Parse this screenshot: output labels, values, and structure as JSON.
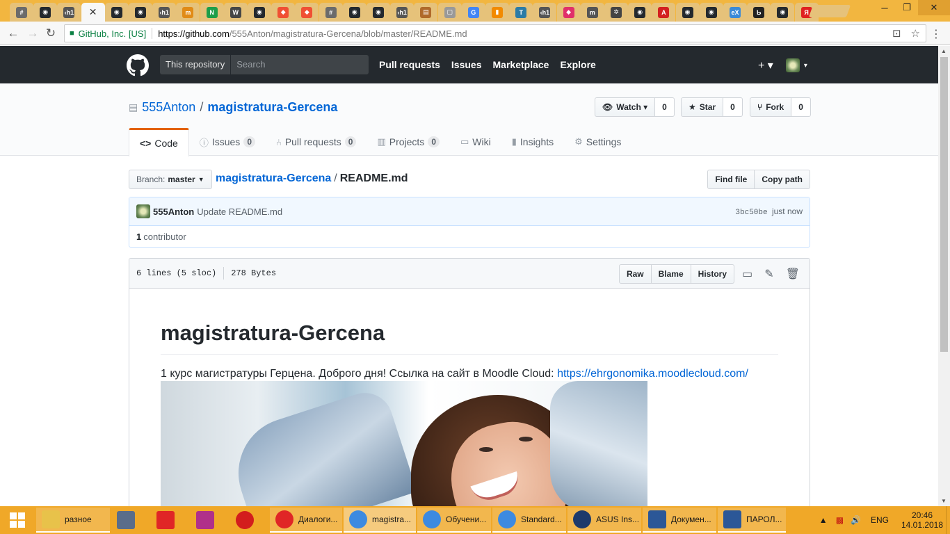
{
  "browser": {
    "tabs": [
      {
        "icon": "hash-icon",
        "color": "#6b6b6b",
        "glyph": "#"
      },
      {
        "icon": "github-icon",
        "color": "#24292e",
        "glyph": "◉"
      },
      {
        "icon": "h1-icon",
        "color": "#555",
        "glyph": "‹h1"
      },
      {
        "icon": "close-icon",
        "color": "#333",
        "glyph": "✕",
        "active": true
      },
      {
        "icon": "github-icon",
        "color": "#24292e",
        "glyph": "◉"
      },
      {
        "icon": "github-icon",
        "color": "#24292e",
        "glyph": "◉"
      },
      {
        "icon": "h1-icon",
        "color": "#555",
        "glyph": "‹h1"
      },
      {
        "icon": "m-icon",
        "color": "#e18b16",
        "glyph": "m"
      },
      {
        "icon": "n-icon",
        "color": "#1e9e4a",
        "glyph": "N"
      },
      {
        "icon": "wordpress-icon",
        "color": "#464646",
        "glyph": "W"
      },
      {
        "icon": "github-icon",
        "color": "#24292e",
        "glyph": "◉"
      },
      {
        "icon": "git-icon",
        "color": "#f05033",
        "glyph": "◆"
      },
      {
        "icon": "git-icon",
        "color": "#f05033",
        "glyph": "◆"
      },
      {
        "icon": "hash-icon",
        "color": "#6b6b6b",
        "glyph": "#"
      },
      {
        "icon": "github-icon",
        "color": "#24292e",
        "glyph": "◉"
      },
      {
        "icon": "github-icon",
        "color": "#24292e",
        "glyph": "◉"
      },
      {
        "icon": "h1-icon",
        "color": "#555",
        "glyph": "‹h1"
      },
      {
        "icon": "image-icon",
        "color": "#b06a2a",
        "glyph": "▤"
      },
      {
        "icon": "page-icon",
        "color": "#999",
        "glyph": "▢"
      },
      {
        "icon": "google-icon",
        "color": "#4285f4",
        "glyph": "G"
      },
      {
        "icon": "chart-icon",
        "color": "#f28a00",
        "glyph": "▮"
      },
      {
        "icon": "t-icon",
        "color": "#2c7ba6",
        "glyph": "T"
      },
      {
        "icon": "h1-icon",
        "color": "#555",
        "glyph": "‹h1"
      },
      {
        "icon": "bookmark-icon",
        "color": "#e0306a",
        "glyph": "◆"
      },
      {
        "icon": "m-icon",
        "color": "#555",
        "glyph": "m"
      },
      {
        "icon": "gear-icon",
        "color": "#444",
        "glyph": "✲"
      },
      {
        "icon": "github-icon",
        "color": "#24292e",
        "glyph": "◉"
      },
      {
        "icon": "opera-icon",
        "color": "#d32020",
        "glyph": "A"
      },
      {
        "icon": "github-icon",
        "color": "#24292e",
        "glyph": "◉"
      },
      {
        "icon": "github-icon",
        "color": "#24292e",
        "glyph": "◉"
      },
      {
        "icon": "ex-icon",
        "color": "#3a8ad8",
        "glyph": "eX"
      },
      {
        "icon": "b-icon",
        "color": "#222",
        "glyph": "Ƅ"
      },
      {
        "icon": "github-icon",
        "color": "#24292e",
        "glyph": "◉"
      },
      {
        "icon": "yandex-icon",
        "color": "#e02020",
        "glyph": "Я"
      }
    ],
    "security_label": "GitHub, Inc. [US]",
    "url_host": "https://github.com",
    "url_path": "/555Anton/magistratura-Gercena/blob/master/README.md"
  },
  "github": {
    "scope_label": "This repository",
    "search_placeholder": "Search",
    "nav": [
      "Pull requests",
      "Issues",
      "Marketplace",
      "Explore"
    ],
    "plus_label": "+ ▾",
    "owner": "555Anton",
    "repo": "magistratura-Gercena",
    "watch": {
      "label": "Watch ▾",
      "count": "0"
    },
    "star": {
      "label": "Star",
      "count": "0"
    },
    "fork": {
      "label": "Fork",
      "count": "0"
    },
    "tabs": {
      "code": "Code",
      "issues": "Issues",
      "issues_count": "0",
      "pulls": "Pull requests",
      "pulls_count": "0",
      "projects": "Projects",
      "projects_count": "0",
      "wiki": "Wiki",
      "insights": "Insights",
      "settings": "Settings"
    },
    "branch_key": "Branch:",
    "branch_val": "master",
    "breadcrumb_repo": "magistratura-Gercena",
    "breadcrumb_file": "README.md",
    "find_file": "Find file",
    "copy_path": "Copy path",
    "commit": {
      "author": "555Anton",
      "message": "Update README.md",
      "sha": "3bc50be",
      "time": "just now",
      "contributors_count": "1",
      "contributors_label": "contributor"
    },
    "file": {
      "lines": "6 lines (5 sloc)",
      "size": "278 Bytes",
      "raw": "Raw",
      "blame": "Blame",
      "history": "History"
    },
    "readme": {
      "title": "magistratura-Gercena",
      "text": "1 курс магистратуры Герцена. Доброго дня! Ссылка на сайт в Moodle Cloud: ",
      "link": "https://ehrgonomika.moodlecloud.com/"
    }
  },
  "taskbar": {
    "apps": [
      {
        "label": "разное",
        "icon": "folder-icon",
        "color": "#e8c24a",
        "state": "open"
      },
      {
        "label": "",
        "icon": "calculator-icon",
        "color": "#5a6d8a",
        "state": ""
      },
      {
        "label": "",
        "icon": "fr-icon",
        "color": "#e02626",
        "state": ""
      },
      {
        "label": "",
        "icon": "camera-icon",
        "color": "#b0308a",
        "state": ""
      },
      {
        "label": "",
        "icon": "opera-icon",
        "color": "#d31d1d",
        "state": ""
      },
      {
        "label": "Диалоги...",
        "icon": "yandex-icon",
        "color": "#e02626",
        "state": "open"
      },
      {
        "label": "magistra...",
        "icon": "chrome-icon",
        "color": "#3d8ae0",
        "state": "active"
      },
      {
        "label": "Обучени...",
        "icon": "chrome-icon",
        "color": "#3d8ae0",
        "state": "open"
      },
      {
        "label": "Standard...",
        "icon": "chrome-icon",
        "color": "#3d8ae0",
        "state": "open"
      },
      {
        "label": "ASUS Ins...",
        "icon": "asus-icon",
        "color": "#1d3a6b",
        "state": "open"
      },
      {
        "label": "Докумен...",
        "icon": "word-icon",
        "color": "#2b5797",
        "state": "open"
      },
      {
        "label": "ПАРОЛ...",
        "icon": "word-icon",
        "color": "#2b5797",
        "state": "open"
      }
    ],
    "lang": "ENG",
    "time": "20:46",
    "date": "14.01.2018"
  }
}
